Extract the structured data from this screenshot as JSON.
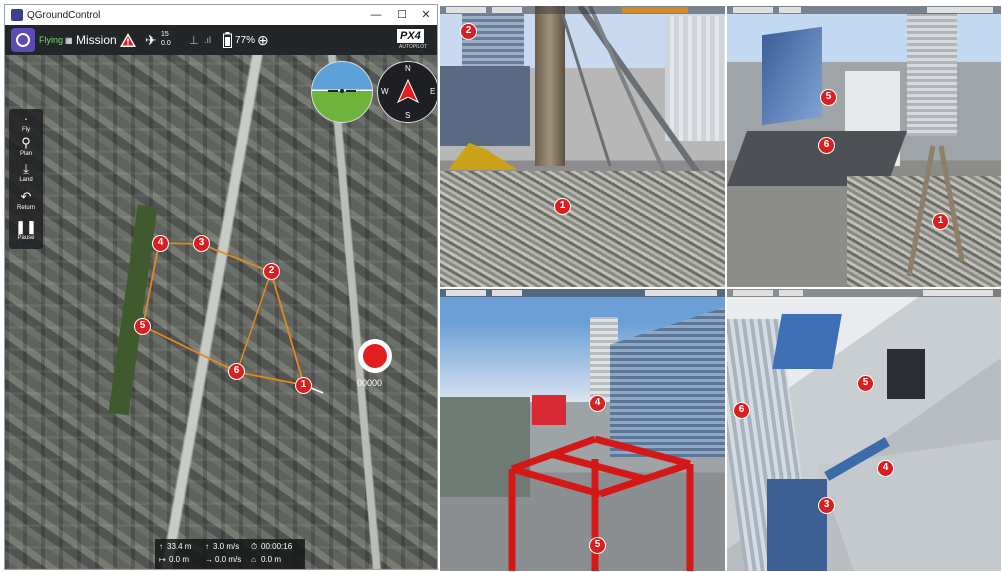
{
  "qgc": {
    "title": "QGroundControl",
    "window_controls": {
      "minimize": "—",
      "maximize": "☐",
      "close": "✕"
    },
    "toolbar": {
      "flight_mode": "Flying",
      "mission_label": "Mission",
      "satellite_count": "15",
      "hdop": "0.0",
      "battery": "77%",
      "brand": "PX4",
      "brand_sub": "AUTOPILOT"
    },
    "tools": [
      {
        "label": "Fly",
        "icon": "fly-icon"
      },
      {
        "label": "Plan",
        "icon": "plan-icon"
      },
      {
        "label": "Land",
        "icon": "land-icon"
      },
      {
        "label": "Return",
        "icon": "return-icon"
      },
      {
        "label": "Pause",
        "icon": "pause-icon"
      }
    ],
    "compass": {
      "n": "N",
      "s": "S",
      "e": "E",
      "w": "W"
    },
    "record_counter": "00000",
    "telemetry": {
      "altitude": "33.4 m",
      "vertical_speed": "3.0 m/s",
      "flight_time": "00:00:16",
      "distance": "0.0 m",
      "horizontal_speed": "0.0 m/s",
      "distance_home": "0.0 m"
    },
    "map_markers": [
      "1",
      "2",
      "3",
      "4",
      "5",
      "6"
    ],
    "colors": {
      "route": "#e28a1e",
      "marker": "#d91f1f",
      "flying": "#7fd36b"
    }
  },
  "views": {
    "top_left_markers": [
      "2",
      "1"
    ],
    "top_right_markers": [
      "5",
      "6",
      "1"
    ],
    "bottom_left_markers": [
      "4",
      "5"
    ],
    "bottom_right_markers": [
      "6",
      "5",
      "4",
      "3"
    ]
  }
}
